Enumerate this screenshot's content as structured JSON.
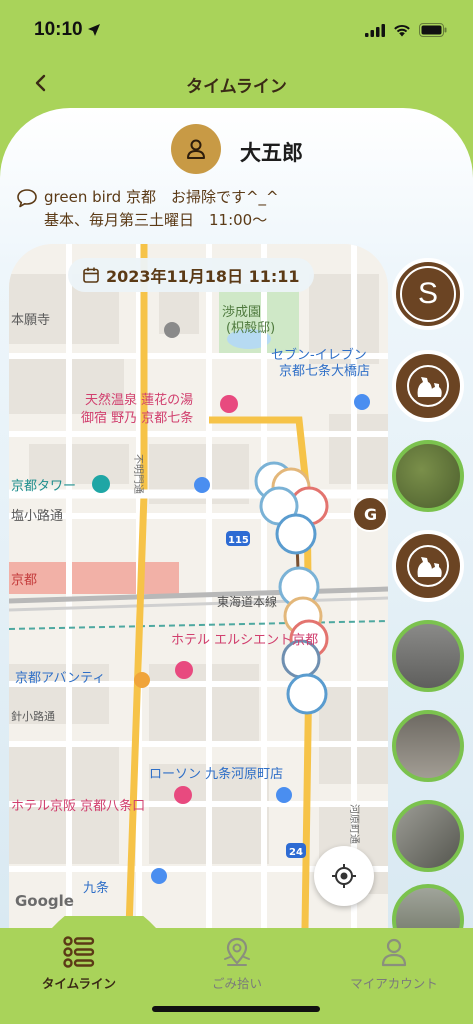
{
  "status_bar": {
    "time": "10:10"
  },
  "header": {
    "title": "タイムライン"
  },
  "profile": {
    "name": "大五郎"
  },
  "post": {
    "line1": "green bird 京都　お掃除です^_^",
    "line2": "基本、毎月第三土曜日　11:00〜"
  },
  "date_chip": {
    "text": "2023年11月18日 11:11"
  },
  "map": {
    "labels": {
      "honganji": "本願寺",
      "shoseien_1": "渉成園",
      "shoseien_2": "(枳殻邸)",
      "seven_1": "セブン-イレブン",
      "seven_2": "京都七条大橋店",
      "onsen_1": "天然温泉 蓮花の湯",
      "onsen_2": "御宿 野乃 京都七条",
      "kyoto_tower": "京都タワー",
      "shiokoji": "塩小路通",
      "kyoto_station": "京都",
      "tokaido": "東海道本線",
      "hotel_elcient": "ホテル エルシエント京都",
      "avanti": "京都アバンティ",
      "lawson": "ローソン 九条河原町店",
      "hotel_keihan": "ホテル京阪 京都八条口",
      "harikoji": "針小路通",
      "kujo": "九条",
      "route_115": "115",
      "route_24": "24",
      "google": "Google",
      "kawaramachi": "河原町通",
      "fuyacho": "不明門通"
    },
    "user_marker": "G"
  },
  "right_rail": {
    "profile_letter": "S"
  },
  "bottom_nav": {
    "items": [
      {
        "label": "タイムライン",
        "active": true
      },
      {
        "label": "ごみ拾い",
        "active": false
      },
      {
        "label": "マイアカウント",
        "active": false
      }
    ]
  },
  "colors": {
    "brand_green": "#a9d35a",
    "brown": "#6b4423",
    "gold": "#c89a45",
    "ring_green": "#7bc24e"
  }
}
